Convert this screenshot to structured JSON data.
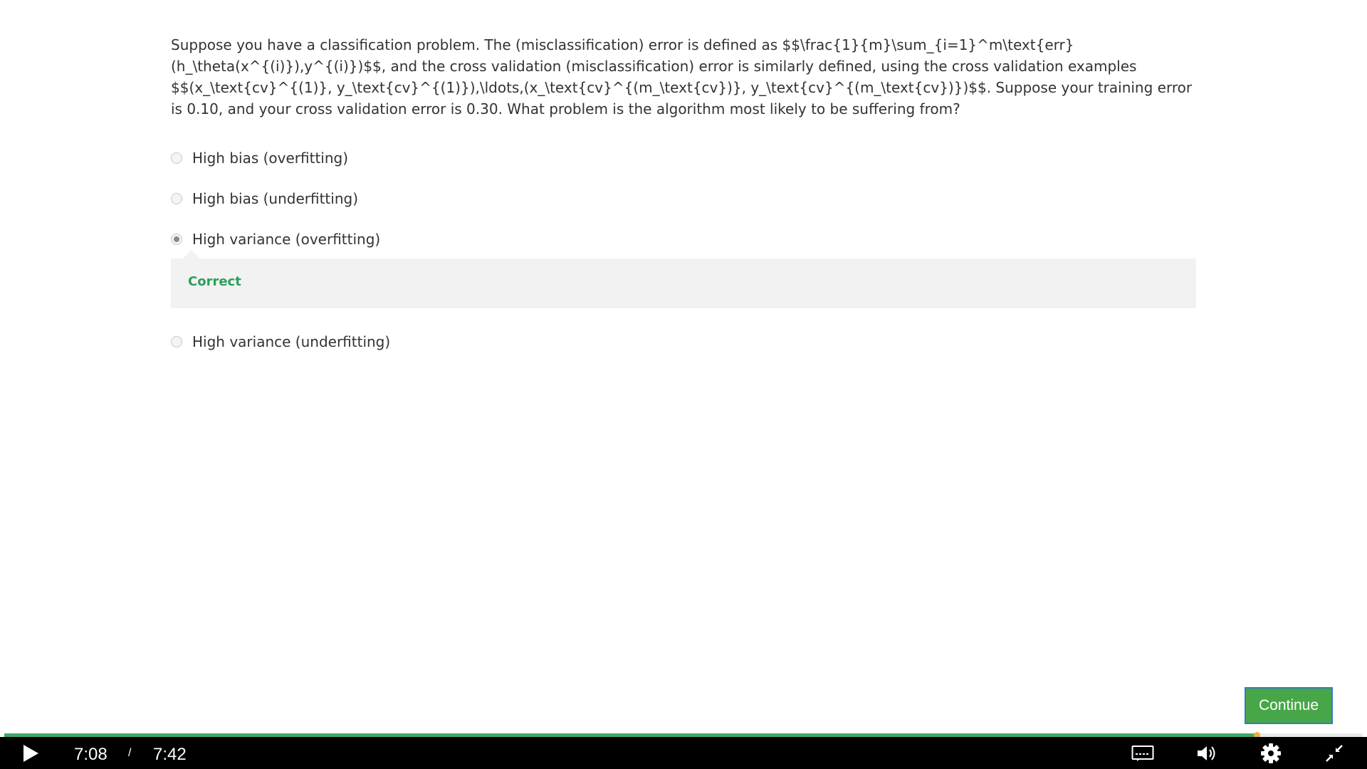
{
  "question": {
    "text": "Suppose you have a classification problem. The (misclassification) error is defined as $$\\frac{1}{m}\\sum_{i=1}^m\\text{err}(h_\\theta(x^{(i)}),y^{(i)})$$, and the cross validation (misclassification) error is similarly defined, using the cross validation examples $$(x_\\text{cv}^{(1)}, y_\\text{cv}^{(1)}),\\ldots,(x_\\text{cv}^{(m_\\text{cv})}, y_\\text{cv}^{(m_\\text{cv})})$$. Suppose your training error is 0.10, and your cross validation error is 0.30. What problem is the algorithm most likely to be suffering from?"
  },
  "options": [
    {
      "label": "High bias (overfitting)",
      "selected": false
    },
    {
      "label": "High bias (underfitting)",
      "selected": false
    },
    {
      "label": "High variance (overfitting)",
      "selected": true
    },
    {
      "label": "High variance (underfitting)",
      "selected": false
    }
  ],
  "feedback": {
    "text": "Correct",
    "color": "#2aa15a"
  },
  "continue_button": {
    "label": "Continue",
    "color": "#47a748"
  },
  "player": {
    "current_time": "7:08",
    "separator": "/",
    "duration": "7:42",
    "progress_fraction": 0.922,
    "icons": [
      "play-icon",
      "captions-icon",
      "volume-icon",
      "settings-icon",
      "exit-fullscreen-icon"
    ]
  }
}
